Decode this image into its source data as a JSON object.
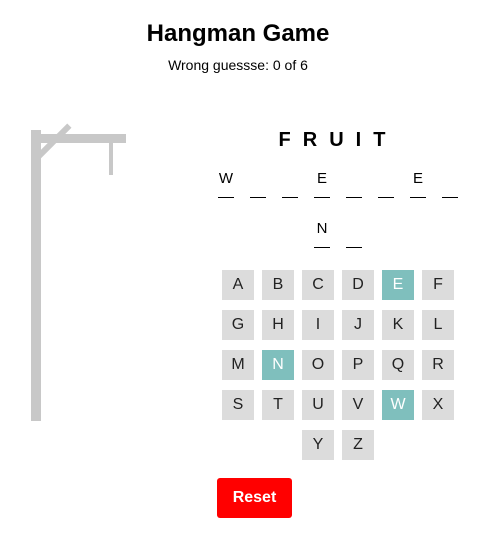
{
  "header": {
    "title": "Hangman Game",
    "status_label": "Wrong guessse:",
    "wrong_count": "0",
    "of_label": "of",
    "max_wrong": "6"
  },
  "category": "FRUIT",
  "word": {
    "row1": [
      "W",
      "",
      "",
      "E",
      "",
      "",
      "E",
      ""
    ],
    "row2": [
      "N",
      ""
    ]
  },
  "keyboard": {
    "rows": [
      [
        "A",
        "B",
        "C",
        "D",
        "E",
        "F"
      ],
      [
        "G",
        "H",
        "I",
        "J",
        "K",
        "L"
      ],
      [
        "M",
        "N",
        "O",
        "P",
        "Q",
        "R"
      ],
      [
        "S",
        "T",
        "U",
        "V",
        "W",
        "X"
      ],
      [
        "Y",
        "Z"
      ]
    ],
    "guessed": [
      "E",
      "N",
      "W"
    ]
  },
  "reset_label": "Reset",
  "colors": {
    "guessed_key": "#7fbfbd",
    "key": "#dcdcdc",
    "reset": "#ff0000",
    "gallows": "#c8c8c8"
  }
}
